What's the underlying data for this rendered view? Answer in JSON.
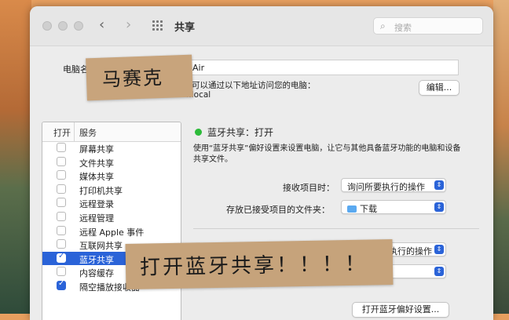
{
  "window": {
    "title": "共享"
  },
  "search": {
    "placeholder": "搜索"
  },
  "computer": {
    "name_label": "电脑名",
    "name_value": "Air",
    "info_text": "可以通过以下地址访问您的电脑：",
    "local_address": "MacBook-Air.local",
    "edit_label": "编辑..."
  },
  "services": {
    "header_on": "打开",
    "header_service": "服务",
    "items": [
      {
        "label": "屏幕共享",
        "checked": false,
        "selected": false
      },
      {
        "label": "文件共享",
        "checked": false,
        "selected": false
      },
      {
        "label": "媒体共享",
        "checked": false,
        "selected": false
      },
      {
        "label": "打印机共享",
        "checked": false,
        "selected": false
      },
      {
        "label": "远程登录",
        "checked": false,
        "selected": false
      },
      {
        "label": "远程管理",
        "checked": false,
        "selected": false
      },
      {
        "label": "远程 Apple 事件",
        "checked": false,
        "selected": false
      },
      {
        "label": "互联网共享",
        "checked": false,
        "selected": false
      },
      {
        "label": "蓝牙共享",
        "checked": true,
        "selected": true
      },
      {
        "label": "内容缓存",
        "checked": false,
        "selected": false
      },
      {
        "label": "隔空播放接收器",
        "checked": true,
        "selected": false
      }
    ]
  },
  "bluetooth": {
    "status": "蓝牙共享：打开",
    "status_color": "#2dbb3a",
    "description_line1": "使用“蓝牙共享”偏好设置来设置电脑，让它与其他具备蓝牙功能的电脑和设备",
    "description_line2": "共享文件。",
    "receive_label": "接收项目时：",
    "receive_value": "询问所要执行的操作",
    "folder_label": "存放已接受项目的文件夹：",
    "folder_value": "下载",
    "browse_value_partial": "执行的操作",
    "open_prefs_label": "打开蓝牙偏好设置..."
  },
  "overlays": {
    "tape_top": "马赛克",
    "tape_bottom": "打开蓝牙共享！！！！"
  },
  "colors": {
    "accent": "#2a63d8",
    "tape": "#c8a47c"
  }
}
